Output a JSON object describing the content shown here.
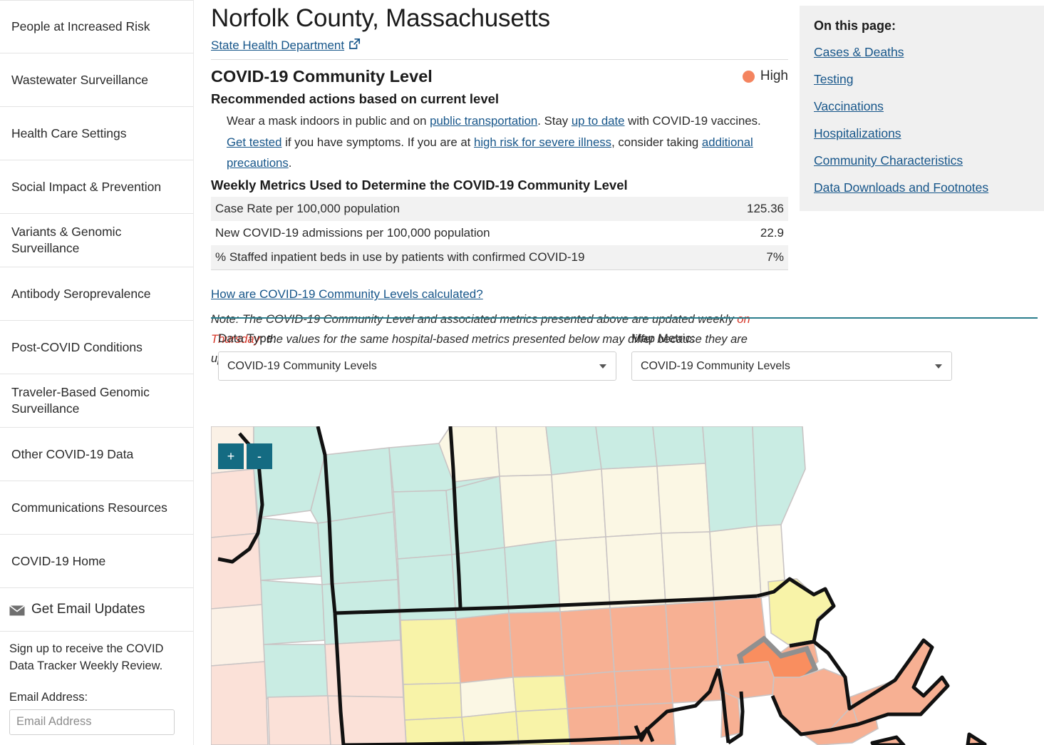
{
  "sidebar": {
    "nav_items": [
      {
        "label": "People at Increased Risk"
      },
      {
        "label": "Wastewater Surveillance"
      },
      {
        "label": "Health Care Settings"
      },
      {
        "label": "Social Impact & Prevention"
      },
      {
        "label": "Variants & Genomic Surveillance"
      },
      {
        "label": "Antibody Seroprevalence"
      },
      {
        "label": "Post-COVID Conditions"
      },
      {
        "label": "Traveler-Based Genomic Surveillance"
      },
      {
        "label": "Other COVID-19 Data"
      },
      {
        "label": "Communications Resources"
      },
      {
        "label": "COVID-19 Home"
      }
    ],
    "email": {
      "header": "Get Email Updates",
      "icon": "envelope-icon",
      "description": "Sign up to receive the COVID Data Tracker Weekly Review.",
      "field_label": "Email Address:",
      "placeholder": "Email Address",
      "value": ""
    }
  },
  "header": {
    "title": "Norfolk County, Massachusetts",
    "dept_link": "State Health Department",
    "external_icon": "external-link-icon"
  },
  "community_level": {
    "heading": "COVID-19 Community Level",
    "level": "High",
    "level_color": "#f4845f",
    "recommended_heading": "Recommended actions based on current level",
    "recommended_text": {
      "p1": "Wear a mask indoors in public and on ",
      "link1": "public transportation",
      "p2": ". Stay ",
      "link2": "up to date",
      "p3": " with COVID-19 vaccines. ",
      "link3": "Get tested",
      "p4": " if you have symptoms. If you are at ",
      "link4": "high risk for severe illness",
      "p5": ", consider taking ",
      "link5": "additional precautions",
      "p6": "."
    },
    "metrics_heading": "Weekly Metrics Used to Determine the COVID-19 Community Level",
    "metrics": [
      {
        "label": "Case Rate per 100,000 population",
        "value": "125.36"
      },
      {
        "label": "New COVID-19 admissions per 100,000 population",
        "value": "22.9"
      },
      {
        "label": "% Staffed inpatient beds in use by patients with confirmed COVID-19",
        "value": "7%"
      }
    ],
    "calc_link": "How are COVID-19 Community Levels calculated?",
    "note": {
      "part1": "Note: The COVID-19 Community Level and associated metrics presented above are updated weekly ",
      "highlight": "on Thursday",
      "part2": "; the values for the same hospital-based metrics presented below may differ because they are updated daily."
    },
    "note_highlight_color": "#d63426"
  },
  "controls": {
    "data_type": {
      "label": "Data Type:",
      "value": "COVID-19 Community Levels",
      "icon": "chevron-down-icon"
    },
    "map_metric": {
      "label": "Map Metric:",
      "value": "COVID-19 Community Levels",
      "icon": "chevron-down-icon"
    }
  },
  "on_this_page": {
    "title": "On this page:",
    "links": [
      "Cases & Deaths",
      "Testing",
      "Vaccinations",
      "Hospitalizations",
      "Community Characteristics",
      "Data Downloads and Footnotes"
    ]
  },
  "map": {
    "zoom_in_label": "+",
    "zoom_out_label": "-",
    "zoom_in_icon": "plus-icon",
    "zoom_out_icon": "minus-icon",
    "selected_county": "Norfolk County",
    "colors": {
      "low": "#c9ece3",
      "low_alt": "#fbf7e4",
      "medium": "#fbf1e6",
      "medium_pink": "#fbe1d8",
      "yellow": "#f8f3a8",
      "high": "#f7b093",
      "high_dark": "#f98e5f",
      "selected_outline": "#909090",
      "state_border": "#111111",
      "county_border": "#c9c4c4"
    }
  }
}
